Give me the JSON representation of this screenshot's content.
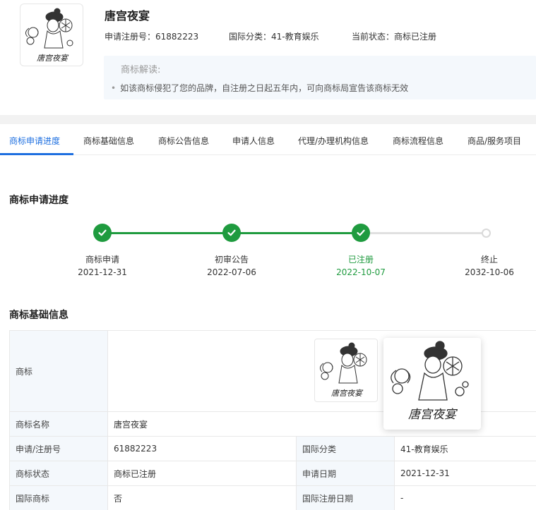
{
  "header": {
    "title": "唐宫夜宴",
    "reg_no_label": "申请注册号：",
    "reg_no": "61882223",
    "class_label": "国际分类：",
    "class_value": "41-教育娱乐",
    "status_label": "当前状态：",
    "status_value": "商标已注册",
    "logo_text": "唐宫夜宴",
    "tip_title": "商标解读:",
    "tip_text": "如该商标侵犯了您的品牌，自注册之日起五年内，可向商标局宣告该商标无效"
  },
  "tabs": [
    {
      "label": "商标申请进度",
      "active": true
    },
    {
      "label": "商标基础信息"
    },
    {
      "label": "商标公告信息"
    },
    {
      "label": "申请人信息"
    },
    {
      "label": "代理/办理机构信息"
    },
    {
      "label": "商标流程信息"
    },
    {
      "label": "商品/服务项目"
    }
  ],
  "progress": {
    "title": "商标申请进度",
    "steps": [
      {
        "label": "商标申请",
        "date": "2021-12-31",
        "done": true
      },
      {
        "label": "初审公告",
        "date": "2022-07-06",
        "done": true
      },
      {
        "label": "已注册",
        "date": "2022-10-07",
        "done": true,
        "current": true
      },
      {
        "label": "终止",
        "date": "2032-10-06",
        "done": false
      }
    ],
    "colors": {
      "done": "#1f9b3f",
      "pending": "#d9d9d9"
    }
  },
  "basic_info": {
    "title": "商标基础信息",
    "trademark_label": "商标",
    "trademark_text": "唐宫夜宴",
    "name_label": "商标名称",
    "name_value": "唐宫夜宴",
    "reg_no_label": "申请/注册号",
    "reg_no_value": "61882223",
    "class_label": "国际分类",
    "class_value": "41-教育娱乐",
    "status_label": "商标状态",
    "status_value": "商标已注册",
    "apply_date_label": "申请日期",
    "apply_date_value": "2021-12-31",
    "intl_label": "国际商标",
    "intl_value": "否",
    "intl_date_label": "国际注册日期",
    "intl_date_value": "-"
  },
  "accent_color": "#1e6fe0"
}
